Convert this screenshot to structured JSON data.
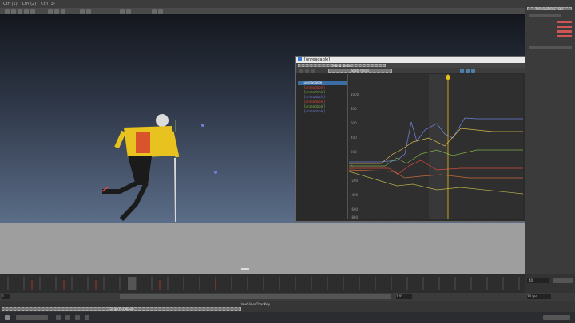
{
  "top_menu": {
    "items": [
      "Ctrl (1)",
      "Ctrl (2)",
      "Ctrl (3)"
    ]
  },
  "graph_editor": {
    "title": "[unreadable]",
    "selected_node": "[unreadable]",
    "channels": [
      "[unreadable]",
      "[unreadable]",
      "[unreadable]",
      "[unreadable]",
      "[unreadable]",
      "[unreadable]"
    ],
    "y_ticks": [
      "1000",
      "800",
      "600",
      "400",
      "200",
      "0",
      "-200",
      "-400",
      "-600",
      "-800"
    ]
  },
  "timeline": {
    "current_frame": "40",
    "range_start": "0",
    "range_end": "120",
    "fps": "24 fps"
  },
  "command_line": {
    "label": "timeSliderChanKey"
  },
  "colors": {
    "viewport_top": "#14171d",
    "viewport_bottom": "#5b6d88",
    "playhead": "#e7c21d",
    "curve_red": "#d84a3c",
    "curve_green": "#7fb04a",
    "curve_blue": "#6e7fd8"
  }
}
